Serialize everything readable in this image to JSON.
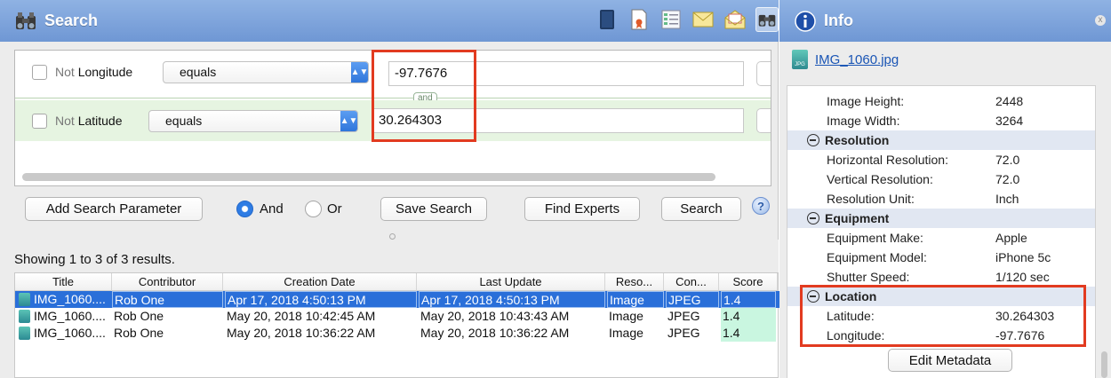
{
  "search_panel": {
    "title": "Search",
    "toolbar_icons": [
      "notebook-icon",
      "document-ribbon-icon",
      "list-form-icon",
      "envelope-icon",
      "open-envelope-icon",
      "binoculars-icon"
    ]
  },
  "criteria": [
    {
      "field": "Longitude",
      "not_label": "Not",
      "operator": "equals",
      "value": "-97.7676"
    },
    {
      "field": "Latitude",
      "not_label": "Not",
      "operator": "equals",
      "value": "30.264303"
    }
  ],
  "connector": "and",
  "controls": {
    "add_param": "Add Search Parameter",
    "and_label": "And",
    "or_label": "Or",
    "save_search": "Save Search",
    "find_experts": "Find Experts",
    "search": "Search",
    "help": "?"
  },
  "results": {
    "summary": "Showing 1 to 3 of 3 results.",
    "columns": [
      "Title",
      "Contributor",
      "Creation Date",
      "Last Update",
      "Reso...",
      "Con...",
      "Score"
    ],
    "rows": [
      {
        "title": "IMG_1060....",
        "contributor": "Rob One",
        "created": "Apr 17, 2018 4:50:13 PM",
        "updated": "Apr 17, 2018 4:50:13 PM",
        "resource": "Image",
        "content": "JPEG",
        "score": "1.4"
      },
      {
        "title": "IMG_1060....",
        "contributor": "Rob One",
        "created": "May 20, 2018 10:42:45 AM",
        "updated": "May 20, 2018 10:43:43 AM",
        "resource": "Image",
        "content": "JPEG",
        "score": "1.4"
      },
      {
        "title": "IMG_1060....",
        "contributor": "Rob One",
        "created": "May 20, 2018 10:36:22 AM",
        "updated": "May 20, 2018 10:36:22 AM",
        "resource": "Image",
        "content": "JPEG",
        "score": "1.4"
      }
    ]
  },
  "info_panel": {
    "title": "Info",
    "file_name": "IMG_1060.jpg",
    "file_icon_text": "JPG",
    "close": "x",
    "rows": [
      {
        "key": "Image Height:",
        "value": "2448"
      },
      {
        "key": "Image Width:",
        "value": "3264"
      },
      {
        "key": "Resolution",
        "value": ""
      },
      {
        "key": "Horizontal Resolution:",
        "value": "72.0"
      },
      {
        "key": "Vertical Resolution:",
        "value": "72.0"
      },
      {
        "key": "Resolution Unit:",
        "value": "Inch"
      },
      {
        "key": "Equipment",
        "value": ""
      },
      {
        "key": "Equipment Make:",
        "value": "Apple"
      },
      {
        "key": "Equipment Model:",
        "value": "iPhone 5c"
      },
      {
        "key": "Shutter Speed:",
        "value": "1/120 sec"
      },
      {
        "key": "Location",
        "value": ""
      },
      {
        "key": "Latitude:",
        "value": "30.264303"
      },
      {
        "key": "Longitude:",
        "value": "-97.7676"
      }
    ],
    "edit_metadata": "Edit Metadata"
  },
  "colors": {
    "titlebar": "#7ea4dc",
    "selected_row": "#2a6fd9",
    "highlight": "#e23b20",
    "latitude_row_bg": "#e6f4e1"
  }
}
